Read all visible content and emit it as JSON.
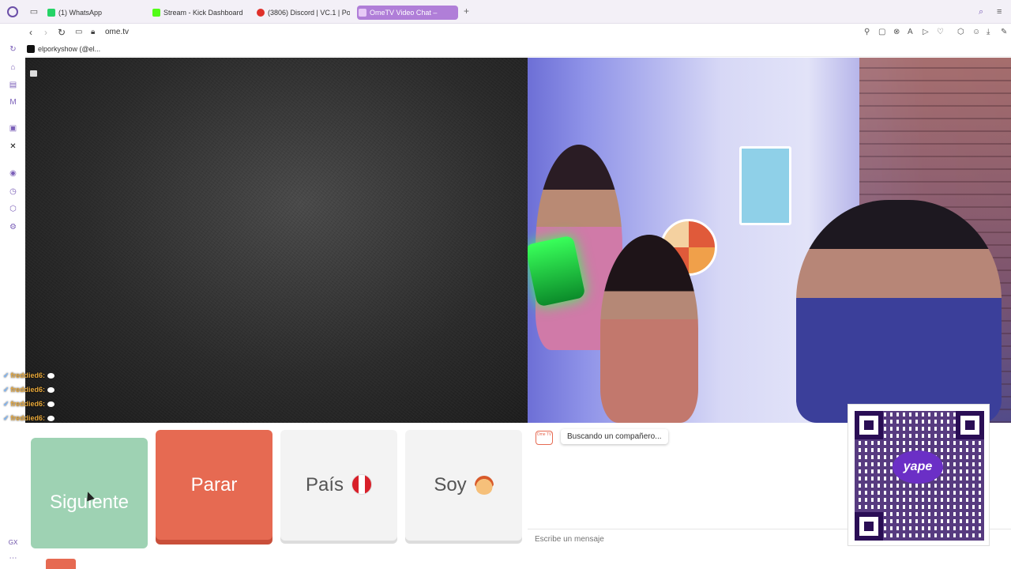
{
  "browser": {
    "tabs": [
      {
        "label": "(1) WhatsApp",
        "favicon_color": "#25d366"
      },
      {
        "label": "Stream - Kick Dashboard",
        "favicon_color": "#53fc18"
      },
      {
        "label": "(3806) Discord | VC.1 | Po",
        "favicon_color": "#e0302a"
      },
      {
        "label": "OmeTV Video Chat –",
        "favicon_color": "#ffffff",
        "active": true
      }
    ],
    "address": "ome.tv",
    "bookmark": "elporkyshow (@el..."
  },
  "stream_chat": [
    {
      "user": "freddied6:"
    },
    {
      "user": "freddied6:"
    },
    {
      "user": "freddied6:"
    },
    {
      "user": "freddied6:"
    }
  ],
  "controls": {
    "next": "Siguiente",
    "stop": "Parar",
    "country": "País",
    "gender": "Soy"
  },
  "chat": {
    "status": "Buscando un compañero...",
    "input_placeholder": "Escribe un mensaje",
    "logo": "Ome TV"
  },
  "qr": {
    "brand": "yape"
  },
  "sidebar_bottom": "GX",
  "colors": {
    "accent": "#7b5fb8",
    "stop": "#e66a52",
    "next": "#9ed2b3"
  }
}
